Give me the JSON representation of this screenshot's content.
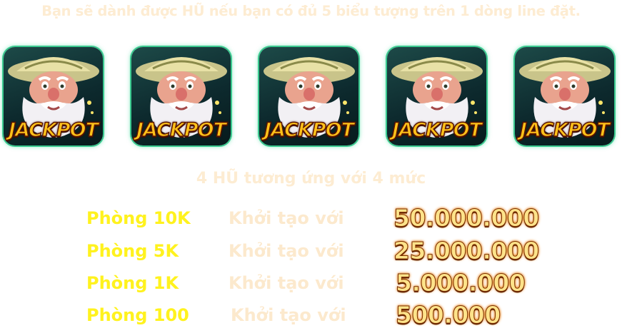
{
  "intro_text": "Bạn sẽ dành được HŨ  nếu bạn có đủ 5 biểu tượng trên 1 dòng line đặt.",
  "symbols": [
    {
      "label": "JACKPOT",
      "icon": "wizard-jackpot-icon"
    },
    {
      "label": "JACKPOT",
      "icon": "wizard-jackpot-icon"
    },
    {
      "label": "JACKPOT",
      "icon": "wizard-jackpot-icon"
    },
    {
      "label": "JACKPOT",
      "icon": "wizard-jackpot-icon"
    },
    {
      "label": "JACKPOT",
      "icon": "wizard-jackpot-icon"
    }
  ],
  "levels_title": "4 HŨ tương ứng với 4 mức",
  "tiers": [
    {
      "room": "Phòng 10K",
      "label": "Khởi tạo với",
      "amount": "50.000.000"
    },
    {
      "room": "Phòng 5K",
      "label": "Khởi tạo với",
      "amount": "25.000.000"
    },
    {
      "room": "Phòng 1K",
      "label": "Khởi tạo với",
      "amount": "5.000.000"
    },
    {
      "room": "Phòng 100",
      "label": "Khởi tạo với",
      "amount": "500.000"
    }
  ],
  "colors": {
    "room_text": "#fff21e",
    "light_text": "#fdecd2",
    "amount_text": "#ffe38a",
    "tile_glow": "#3ac98f",
    "jackpot_text": "#ffc21a"
  }
}
